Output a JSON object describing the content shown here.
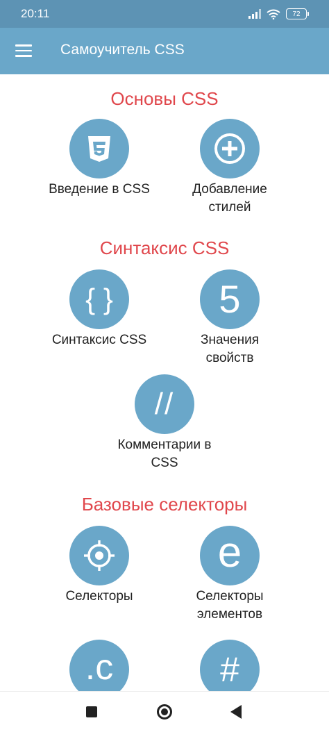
{
  "status": {
    "time": "20:11",
    "battery": "72"
  },
  "appbar": {
    "title": "Самоучитель CSS"
  },
  "sections": [
    {
      "title": "Основы CSS"
    },
    {
      "title": "Синтаксис CSS"
    },
    {
      "title": "Базовые селекторы"
    }
  ],
  "tiles": {
    "intro": {
      "label": "Введение в CSS",
      "icon": "css3-icon"
    },
    "add": {
      "label1": "Добавление",
      "label2": "стилей",
      "icon": "plus-circle-icon"
    },
    "syntax": {
      "label": "Синтаксис CSS",
      "glyph": "{ }",
      "icon": "braces-icon"
    },
    "values": {
      "label1": "Значения",
      "label2": "свойств",
      "glyph": "5",
      "icon": "number-five-icon"
    },
    "comments": {
      "label1": "Комментарии в",
      "label2": "CSS",
      "glyph": "//",
      "icon": "double-slash-icon"
    },
    "selectors": {
      "label": "Селекторы",
      "icon": "crosshair-icon"
    },
    "element-selectors": {
      "label1": "Селекторы",
      "label2": "элементов",
      "glyph": "e",
      "icon": "letter-e-icon"
    },
    "class-selector": {
      "glyph": ".c",
      "icon": "dot-c-icon"
    },
    "id-selector": {
      "glyph": "#",
      "icon": "hash-icon"
    }
  },
  "colors": {
    "primary": "#6aa7c9",
    "statusbar": "#5d93b4",
    "section_title": "#e0474c"
  }
}
